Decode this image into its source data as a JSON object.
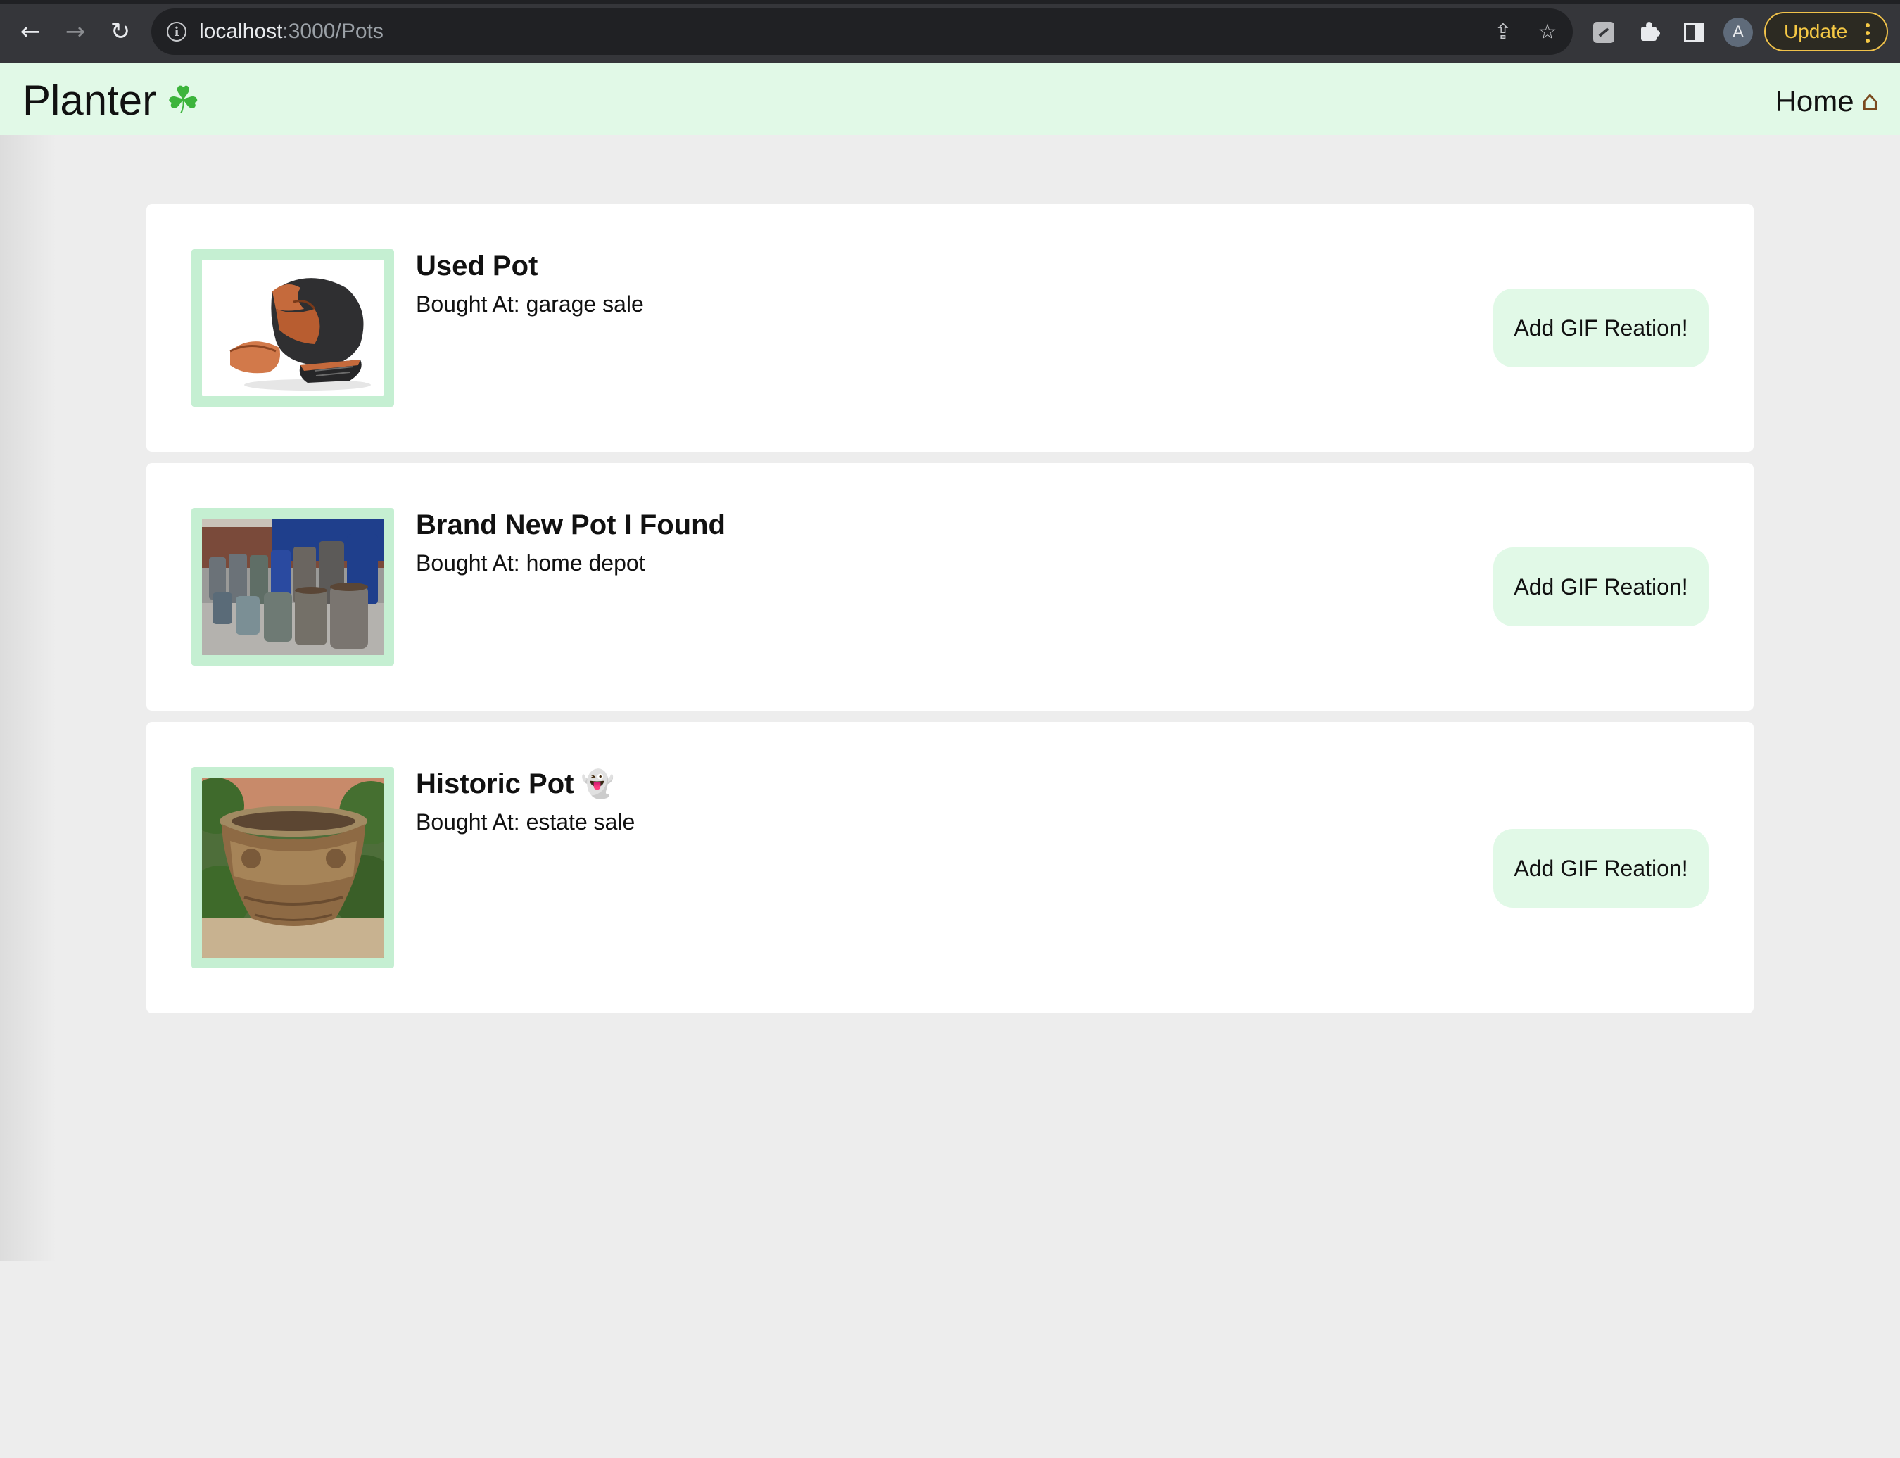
{
  "browser": {
    "url_host": "localhost",
    "url_path": ":3000/Pots",
    "update_label": "Update",
    "profile_initial": "A",
    "icons": {
      "back": "←",
      "forward": "→",
      "reload": "↻",
      "share": "⇪",
      "bookmark": "☆"
    }
  },
  "header": {
    "brand": "Planter",
    "brand_emoji": "☘",
    "home_label": "Home",
    "home_emoji": "⌂"
  },
  "pots": [
    {
      "title": "Used Pot",
      "title_emoji": "",
      "bought_at": "Bought At: garage sale",
      "button_label": "Add GIF Reation!",
      "image": "broken-terracotta-pot"
    },
    {
      "title": "Brand New Pot I Found",
      "title_emoji": "",
      "bought_at": "Bought At: home depot",
      "button_label": "Add GIF Reation!",
      "image": "row-of-ceramic-pots"
    },
    {
      "title": "Historic Pot",
      "title_emoji": "👻",
      "bought_at": "Bought At: estate sale",
      "button_label": "Add GIF Reation!",
      "image": "ornate-stone-urn"
    }
  ]
}
